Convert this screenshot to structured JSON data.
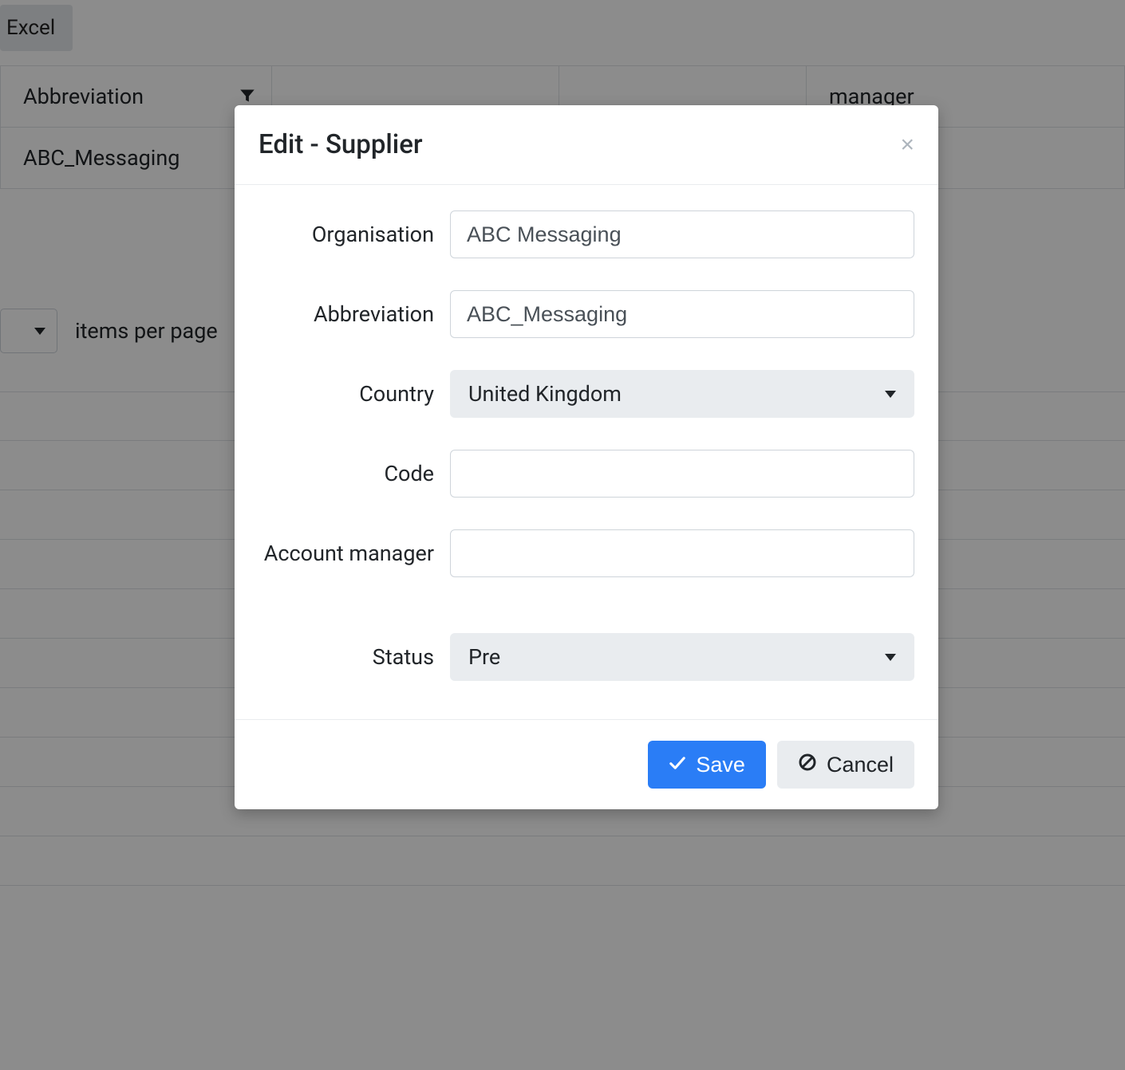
{
  "background": {
    "export_button_fragment": " Excel",
    "columns": {
      "abbreviation": "Abbreviation",
      "manager_fragment": "manager"
    },
    "row1_abbrev": "ABC_Messaging",
    "pager_label": "items per page"
  },
  "modal": {
    "title": "Edit - Supplier",
    "fields": {
      "organisation": {
        "label": "Organisation",
        "value": "ABC Messaging"
      },
      "abbreviation": {
        "label": "Abbreviation",
        "value": "ABC_Messaging"
      },
      "country": {
        "label": "Country",
        "value": "United Kingdom"
      },
      "code": {
        "label": "Code",
        "value": ""
      },
      "account_manager": {
        "label": "Account manager",
        "value": ""
      },
      "status": {
        "label": "Status",
        "value": "Pre"
      }
    },
    "save_label": "Save",
    "cancel_label": "Cancel"
  }
}
